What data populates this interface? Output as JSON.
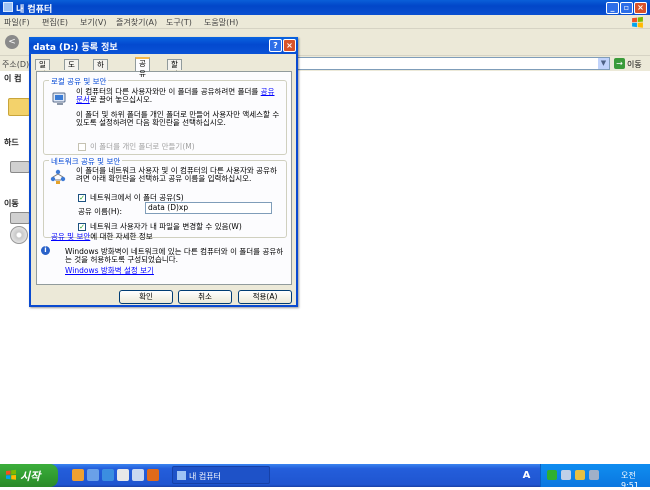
{
  "window": {
    "title": "내 컴퓨터",
    "menu": [
      "파일(F)",
      "편집(E)",
      "보기(V)",
      "즐겨찾기(A)",
      "도구(T)",
      "도움말(H)"
    ],
    "back_glyph": "<",
    "address_label": "주소(D)",
    "go_label": "이동",
    "side": {
      "label_top": "이 컴",
      "label_hard": "하드",
      "label_removable": "이동"
    }
  },
  "dialog": {
    "title": "data (D:) 등록 정보",
    "tabs": [
      "일반",
      "도구",
      "하드웨어",
      "공유",
      "할당량"
    ],
    "active_tab": "공유",
    "local": {
      "title": "로컬 공유 및 보안",
      "text1": "이 컴퓨터의 다른 사용자와만 이 폴더를 공유하려면 폴더를 ",
      "text1_link": "공유 문서",
      "text1_tail": "로 끌어 놓으십시오.",
      "text2": "이 폴더 및 하위 폴더를 개인 폴더로 만들어 사용자만 액세스할 수 있도록 설정하려면 다음 확인란을 선택하십시오.",
      "private_label": "이 폴더를 개인 폴더로 만들기(M)"
    },
    "network": {
      "title": "네트워크 공유 및 보안",
      "text": "이 폴더를 네트워크 사용자 및 이 컴퓨터의 다른 사용자와 공유하려면 아래 확인란을 선택하고 공유 이름을 입력하십시오.",
      "share_label": "네트워크에서 이 폴더 공유(S)",
      "share_name_label": "공유 이름(H):",
      "share_name_value": "data (D)xp",
      "allow_change_label": "네트워크 사용자가 내 파일을 변경할 수 있음(W)",
      "more_link": "공유 및 보안",
      "more_tail": "에 대한 자세한 정보"
    },
    "firewall": {
      "text": "Windows 방화벽이 네트워크에 있는 다른 컴퓨터와 이 폴더를 공유하는 것을 허용하도록 구성되었습니다.",
      "link": "Windows 방화벽 설정 보기"
    },
    "buttons": {
      "ok": "확인",
      "cancel": "취소",
      "apply": "적용(A)"
    }
  },
  "taskbar": {
    "start": "시작",
    "task_title": "내 컴퓨터",
    "ime": "A",
    "clock": "오전 9:51"
  },
  "icons": [
    "windows-flag-icon",
    "computer-icon",
    "folder-icon",
    "drive-icon",
    "cd-drive-icon",
    "share-users-icon",
    "info-icon"
  ]
}
